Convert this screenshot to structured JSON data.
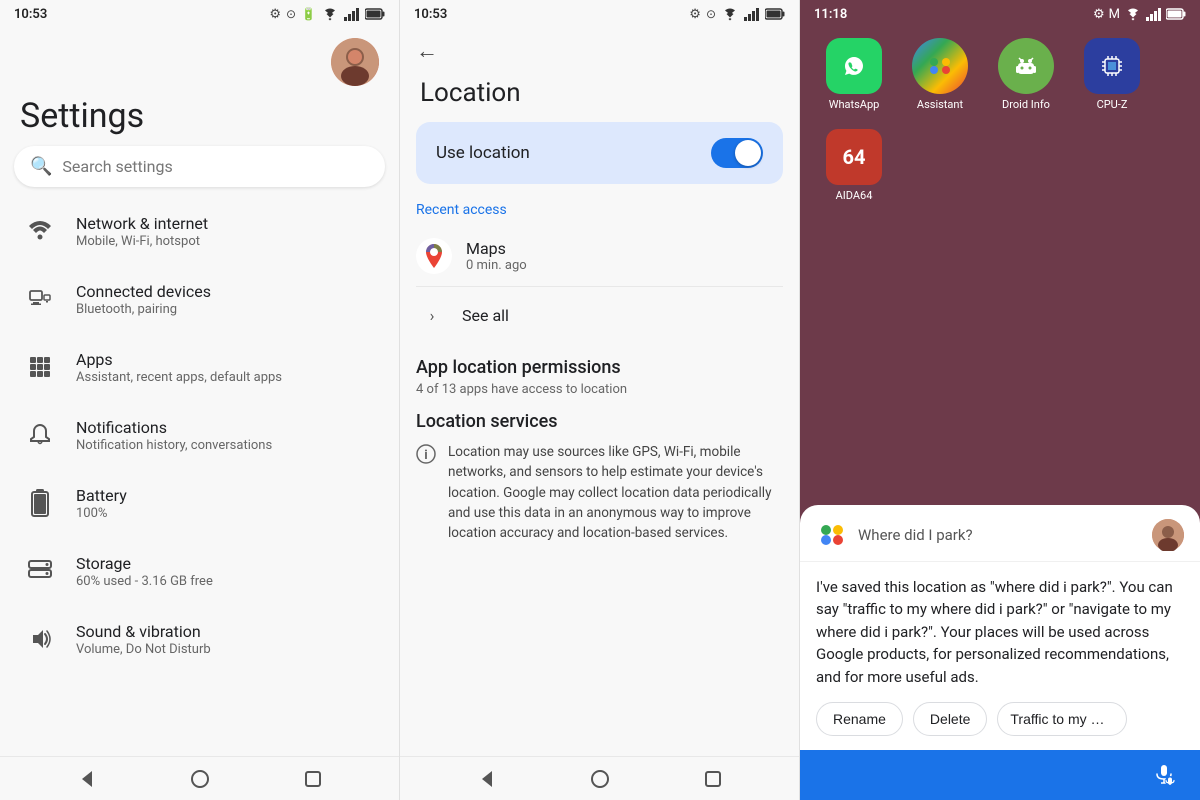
{
  "panel1": {
    "statusBar": {
      "time": "10:53",
      "icons": [
        "settings-icon",
        "cast-icon",
        "battery-icon"
      ]
    },
    "avatar": {
      "alt": "User avatar"
    },
    "title": "Settings",
    "searchPlaceholder": "Search settings",
    "items": [
      {
        "id": "network",
        "icon": "📶",
        "title": "Network & internet",
        "subtitle": "Mobile, Wi-Fi, hotspot"
      },
      {
        "id": "connected",
        "icon": "📱",
        "title": "Connected devices",
        "subtitle": "Bluetooth, pairing"
      },
      {
        "id": "apps",
        "icon": "⊞",
        "title": "Apps",
        "subtitle": "Assistant, recent apps, default apps"
      },
      {
        "id": "notifications",
        "icon": "🔔",
        "title": "Notifications",
        "subtitle": "Notification history, conversations"
      },
      {
        "id": "battery",
        "icon": "🔋",
        "title": "Battery",
        "subtitle": "100%"
      },
      {
        "id": "storage",
        "icon": "💾",
        "title": "Storage",
        "subtitle": "60% used - 3.16 GB free"
      },
      {
        "id": "sound",
        "icon": "🔊",
        "title": "Sound & vibration",
        "subtitle": "Volume, Do Not Disturb"
      }
    ],
    "bottomNav": {
      "back": "◁",
      "home": "●",
      "recent": "■"
    }
  },
  "panel2": {
    "statusBar": {
      "time": "10:53",
      "icons": [
        "settings-icon",
        "cast-icon",
        "battery-icon"
      ]
    },
    "backIcon": "←",
    "title": "Location",
    "useLocation": {
      "label": "Use location",
      "enabled": true
    },
    "recentAccess": "Recent access",
    "mapsApp": {
      "name": "Maps",
      "time": "0 min. ago"
    },
    "seeAll": "See all",
    "appPermissions": {
      "title": "App location permissions",
      "subtitle": "4 of 13 apps have access to location"
    },
    "locationServices": {
      "title": "Location services",
      "info": "Location may use sources like GPS, Wi-Fi, mobile networks, and sensors to help estimate your device's location. Google may collect location data periodically and use this data in an anonymous way to improve location accuracy and location-based services."
    },
    "bottomNav": {
      "back": "◁",
      "home": "●",
      "recent": "■"
    }
  },
  "panel3": {
    "statusBar": {
      "time": "11:18",
      "icons": [
        "settings-icon",
        "mail-icon",
        "wifi-icon",
        "signal-icon",
        "battery-icon"
      ]
    },
    "apps": [
      {
        "id": "whatsapp",
        "label": "WhatsApp",
        "icon": "💬",
        "color": "#25d366"
      },
      {
        "id": "assistant",
        "label": "Assistant",
        "icon": "✦",
        "color": "#4285f4"
      },
      {
        "id": "droid",
        "label": "Droid Info",
        "icon": "🤖",
        "color": "#6ab04c"
      },
      {
        "id": "cpu-z",
        "label": "CPU-Z",
        "icon": "⚡",
        "color": "#2c3e9f"
      },
      {
        "id": "aida64",
        "label": "AIDA64",
        "icon": "64",
        "color": "#c0392b"
      }
    ],
    "assistant": {
      "query": "Where did I park?",
      "response": "I've saved this location as \"where did i park?\". You can say \"traffic to my where did i park?\" or \"navigate to my where did i park?\". Your places will be used across Google products, for personalized recommendations, and for more useful ads.",
      "actions": {
        "rename": "Rename",
        "delete": "Delete",
        "traffic": "Traffic to my where di"
      }
    },
    "bottomNav": {
      "back": "◁",
      "home": "●",
      "recent": "■"
    }
  }
}
